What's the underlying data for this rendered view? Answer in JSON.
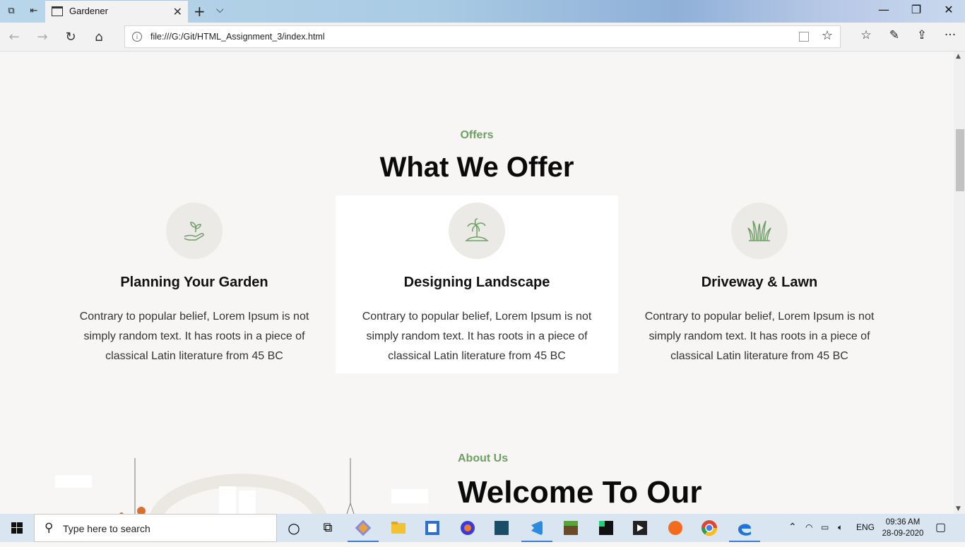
{
  "browser": {
    "tab_title": "Gardener",
    "tab_close": "✕",
    "new_tab": "+",
    "tab_menu": "⌵",
    "url": "file:///G:/Git/HTML_Assignment_3/index.html",
    "window": {
      "minimize": "—",
      "restore": "❐",
      "close": "✕"
    }
  },
  "offers": {
    "eyebrow": "Offers",
    "heading": "What We Offer",
    "cards": [
      {
        "title": "Planning Your Garden",
        "body": "Contrary to popular belief, Lorem Ipsum is not simply random text. It has roots in a piece of classical Latin literature from 45 BC",
        "icon": "hand-sprout-icon"
      },
      {
        "title": "Designing Landscape",
        "body": "Contrary to popular belief, Lorem Ipsum is not simply random text. It has roots in a piece of classical Latin literature from 45 BC",
        "icon": "palm-island-icon"
      },
      {
        "title": "Driveway & Lawn",
        "body": "Contrary to popular belief, Lorem Ipsum is not simply random text. It has roots in a piece of classical Latin literature from 45 BC",
        "icon": "grass-icon"
      }
    ]
  },
  "about": {
    "eyebrow": "About Us",
    "heading": "Welcome To Our"
  },
  "taskbar": {
    "search_placeholder": "Type here to search",
    "language": "ENG",
    "time": "09:36 AM",
    "date": "28-09-2020"
  },
  "colors": {
    "accent_green": "#6ea064",
    "page_bg": "#f7f6f4"
  }
}
